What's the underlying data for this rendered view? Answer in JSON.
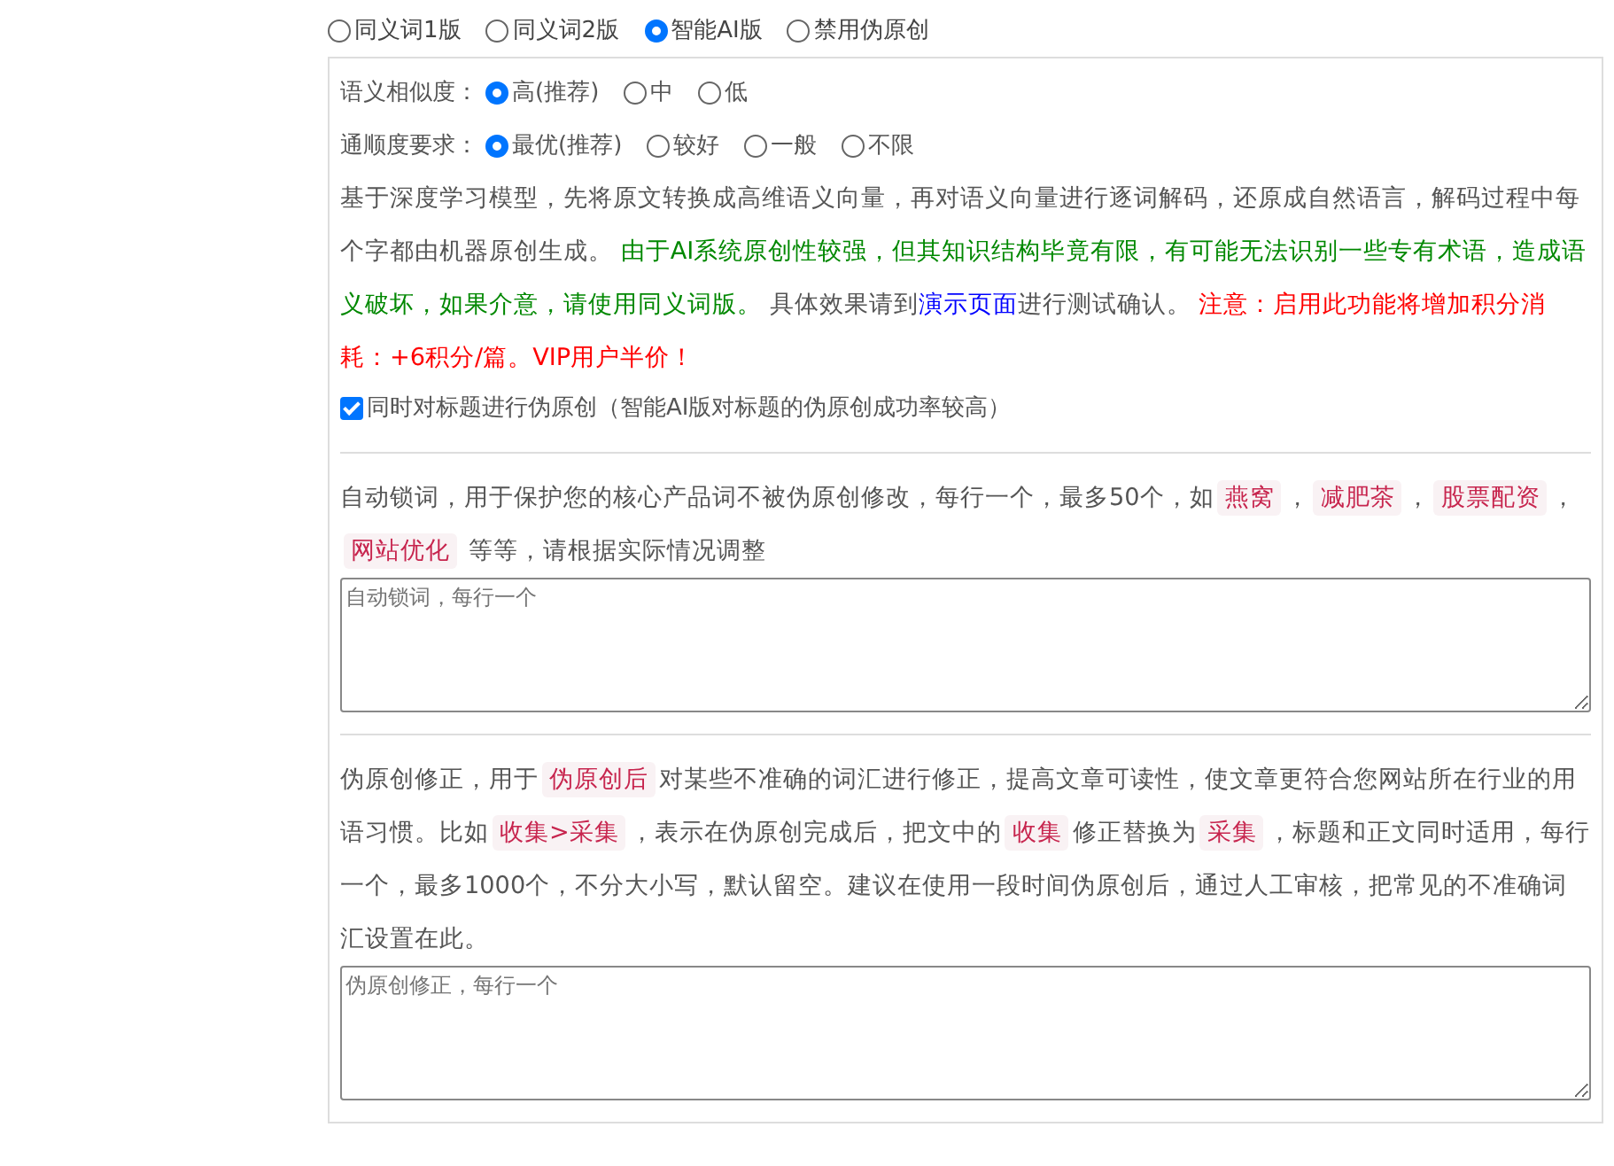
{
  "modes": [
    {
      "label": "同义词1版",
      "selected": false
    },
    {
      "label": "同义词2版",
      "selected": false
    },
    {
      "label": "智能AI版",
      "selected": true
    },
    {
      "label": "禁用伪原创",
      "selected": false
    }
  ],
  "similarity": {
    "label": "语义相似度：",
    "options": [
      {
        "label": "高(推荐)",
        "selected": true
      },
      {
        "label": "中",
        "selected": false
      },
      {
        "label": "低",
        "selected": false
      }
    ]
  },
  "fluency": {
    "label": "通顺度要求：",
    "options": [
      {
        "label": "最优(推荐)",
        "selected": true
      },
      {
        "label": "较好",
        "selected": false
      },
      {
        "label": "一般",
        "selected": false
      },
      {
        "label": "不限",
        "selected": false
      }
    ]
  },
  "description": [
    {
      "kind": "text",
      "text": "基于深度学习模型，先将原文转换成高维语义向量，再对语义向量进行逐词解码，还原成自然语言，解码过程中每个字都由机器原创生成。 "
    },
    {
      "kind": "note",
      "text": "由于AI系统原创性较强，但其知识结构毕竟有限，有可能无法识别一些专有术语，造成语义破坏，如果介意，请使用同义词版。"
    },
    {
      "kind": "text",
      "text": " 具体效果请到"
    },
    {
      "kind": "link",
      "text": "演示页面"
    },
    {
      "kind": "text",
      "text": "进行测试确认。 "
    },
    {
      "kind": "warning",
      "text": "注意：启用此功能将增加积分消耗：+6积分/篇。VIP用户半价！"
    }
  ],
  "title_option": {
    "label": "同时对标题进行伪原创（智能AI版对标题的伪原创成功率较高）",
    "checked": true
  },
  "lock_words": {
    "description": [
      {
        "kind": "text",
        "text": "自动锁词，用于保护您的核心产品词不被伪原创修改，每行一个，最多50个，如"
      },
      {
        "kind": "code",
        "text": "燕窝"
      },
      {
        "kind": "text",
        "text": "，"
      },
      {
        "kind": "code",
        "text": "减肥茶"
      },
      {
        "kind": "text",
        "text": "，"
      },
      {
        "kind": "code",
        "text": "股票配资"
      },
      {
        "kind": "text",
        "text": "，"
      },
      {
        "kind": "code",
        "text": "网站优化"
      },
      {
        "kind": "text",
        "text": " 等等，请根据实际情况调整"
      }
    ],
    "placeholder": "自动锁词，每行一个"
  },
  "correction": {
    "description": [
      {
        "kind": "text",
        "text": "伪原创修正，用于"
      },
      {
        "kind": "code",
        "text": "伪原创后"
      },
      {
        "kind": "text",
        "text": "对某些不准确的词汇进行修正，提高文章可读性，使文章更符合您网站所在行业的用语习惯。比如"
      },
      {
        "kind": "code",
        "text": "收集>采集"
      },
      {
        "kind": "text",
        "text": "，表示在伪原创完成后，把文中的"
      },
      {
        "kind": "code",
        "text": "收集"
      },
      {
        "kind": "text",
        "text": "修正替换为"
      },
      {
        "kind": "code",
        "text": "采集"
      },
      {
        "kind": "text",
        "text": "，标题和正文同时适用，每行一个，最多1000个，不分大小写，默认留空。建议在使用一段时间伪原创后，通过人工审核，把常见的不准确词汇设置在此。"
      }
    ],
    "placeholder": "伪原创修正，每行一个"
  }
}
